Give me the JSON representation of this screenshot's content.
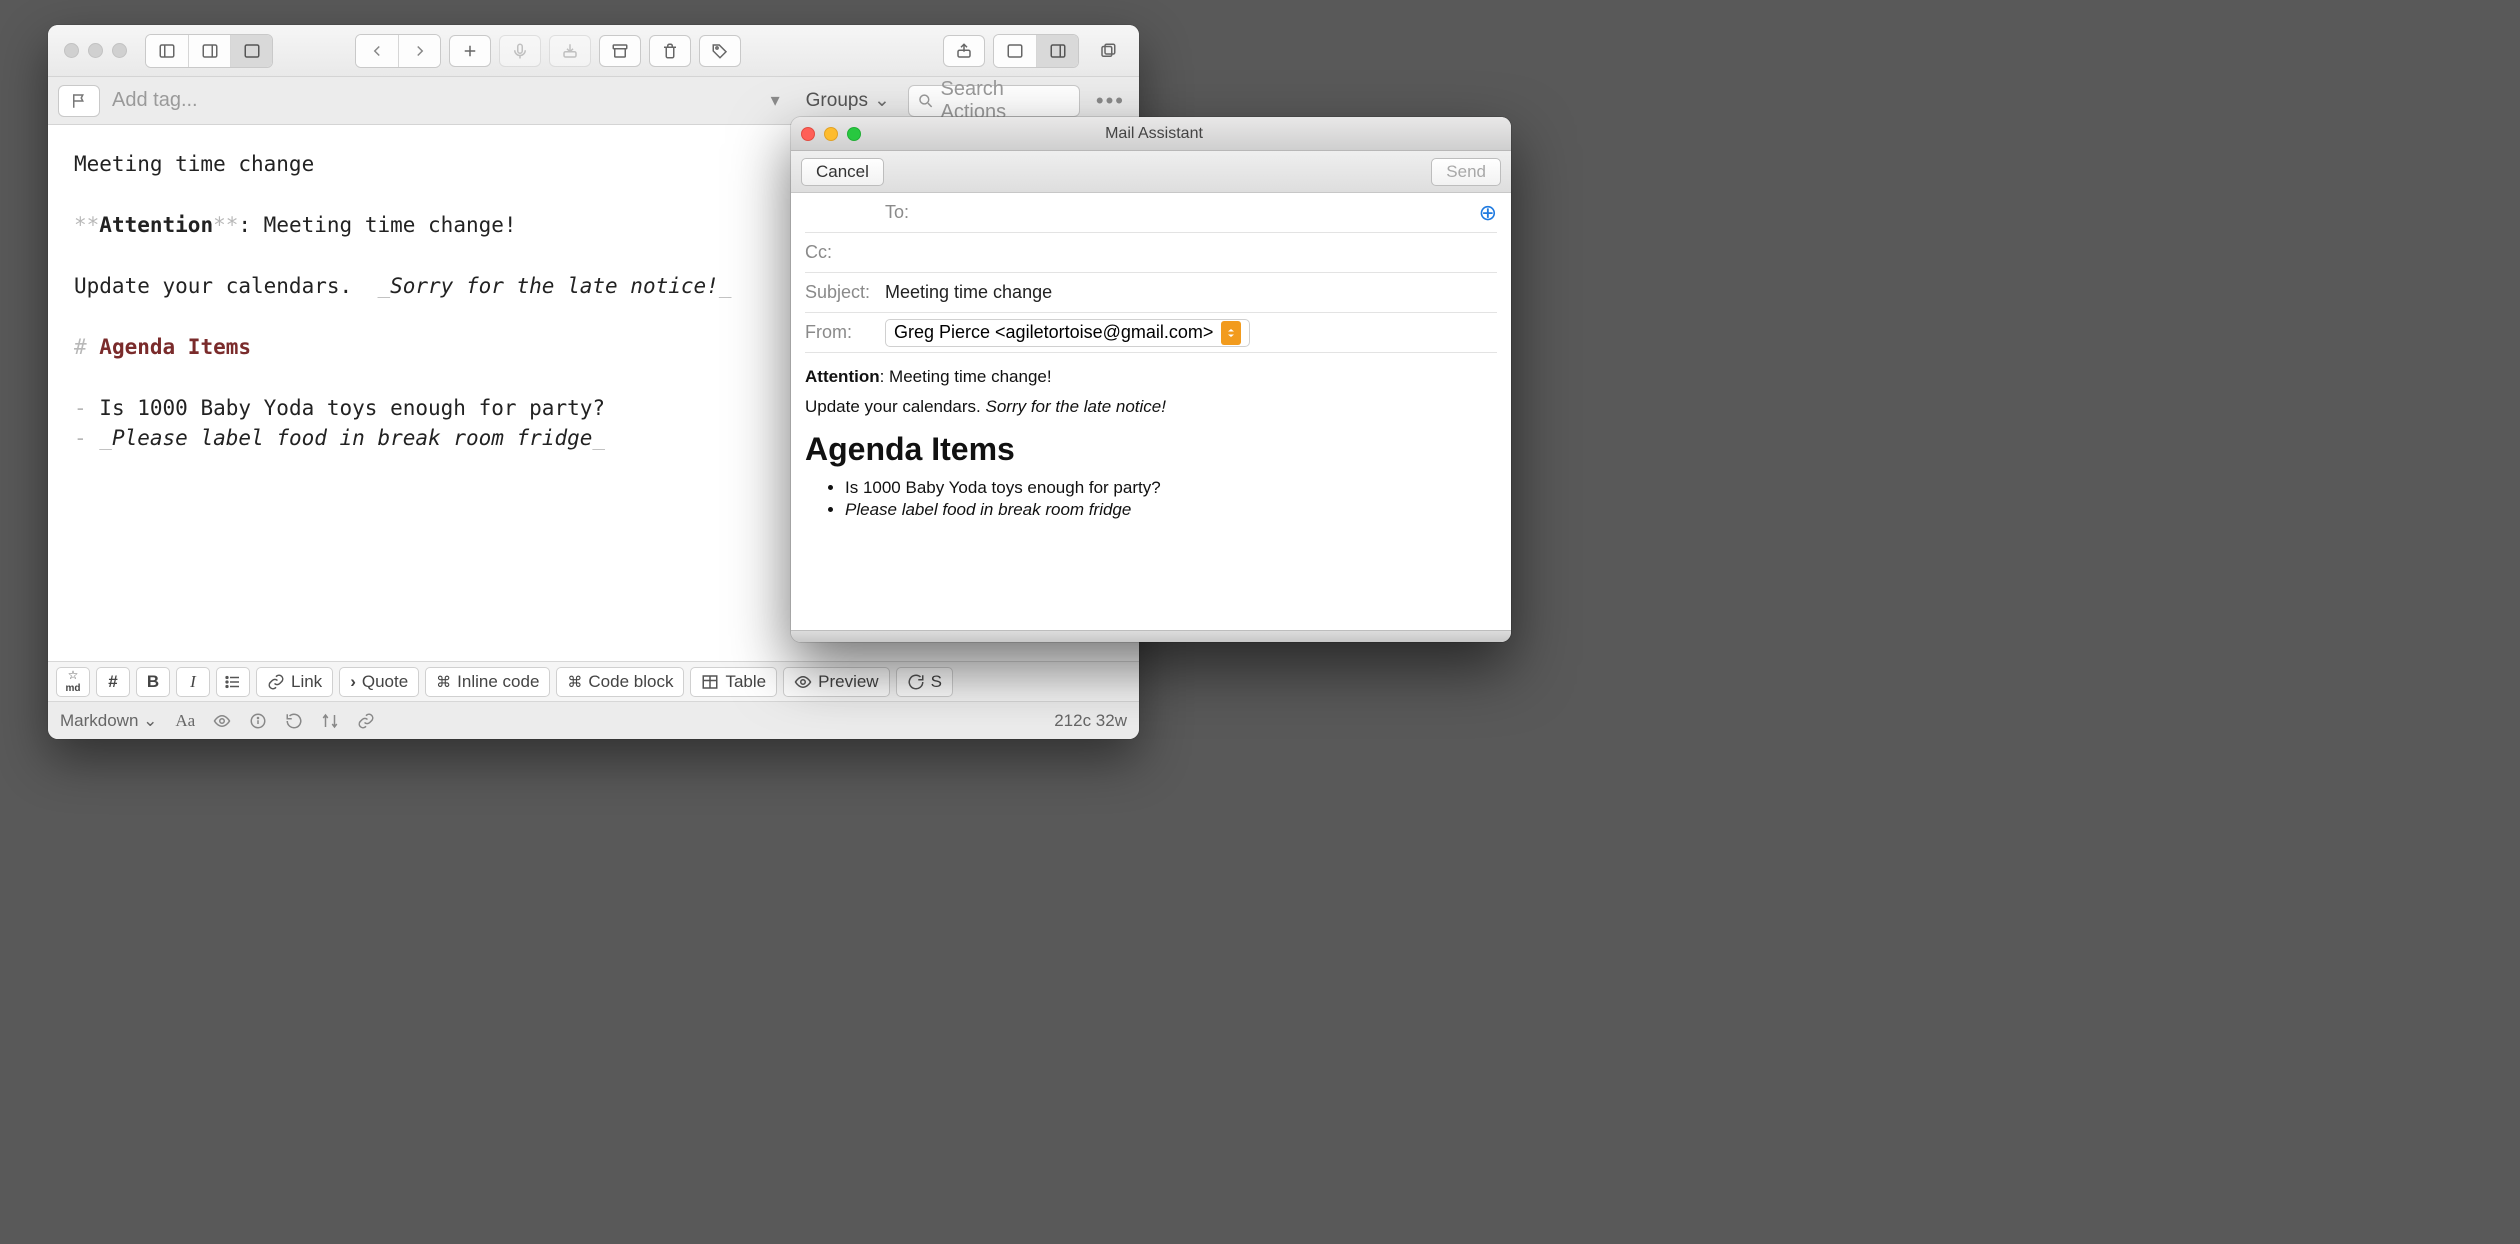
{
  "editor": {
    "tagbar": {
      "add_tag_placeholder": "Add tag...",
      "groups_label": "Groups",
      "search_placeholder": "Search Actions"
    },
    "content": {
      "line1": "Meeting time change",
      "bold_word": "Attention",
      "after_bold": ": Meeting time change!",
      "line3_pre": "Update your calendars.  ",
      "line3_ital": "Sorry for the late notice!",
      "heading": "Agenda Items",
      "bullet1": "Is 1000 Baby Yoda toys enough for party?",
      "bullet2": "Please label food in break room fridge"
    },
    "toolbar": {
      "link": "Link",
      "quote": "Quote",
      "inline_code": "Inline code",
      "code_block": "Code block",
      "table": "Table",
      "preview": "Preview",
      "shortcut_partial": "S"
    },
    "status": {
      "syntax": "Markdown",
      "counts": "212c 32w"
    }
  },
  "mail": {
    "title": "Mail Assistant",
    "cancel": "Cancel",
    "send": "Send",
    "labels": {
      "to": "To:",
      "cc": "Cc:",
      "subject": "Subject:",
      "from": "From:"
    },
    "subject_value": "Meeting time change",
    "from_value": "Greg Pierce <agiletortoise@gmail.com>",
    "body": {
      "attention": "Attention",
      "attention_rest": ": Meeting time change!",
      "p2_pre": "Update your calendars. ",
      "p2_ital": "Sorry for the late notice!",
      "heading": "Agenda Items",
      "li1": "Is 1000 Baby Yoda toys enough for party?",
      "li2": "Please label food in break room fridge"
    }
  }
}
